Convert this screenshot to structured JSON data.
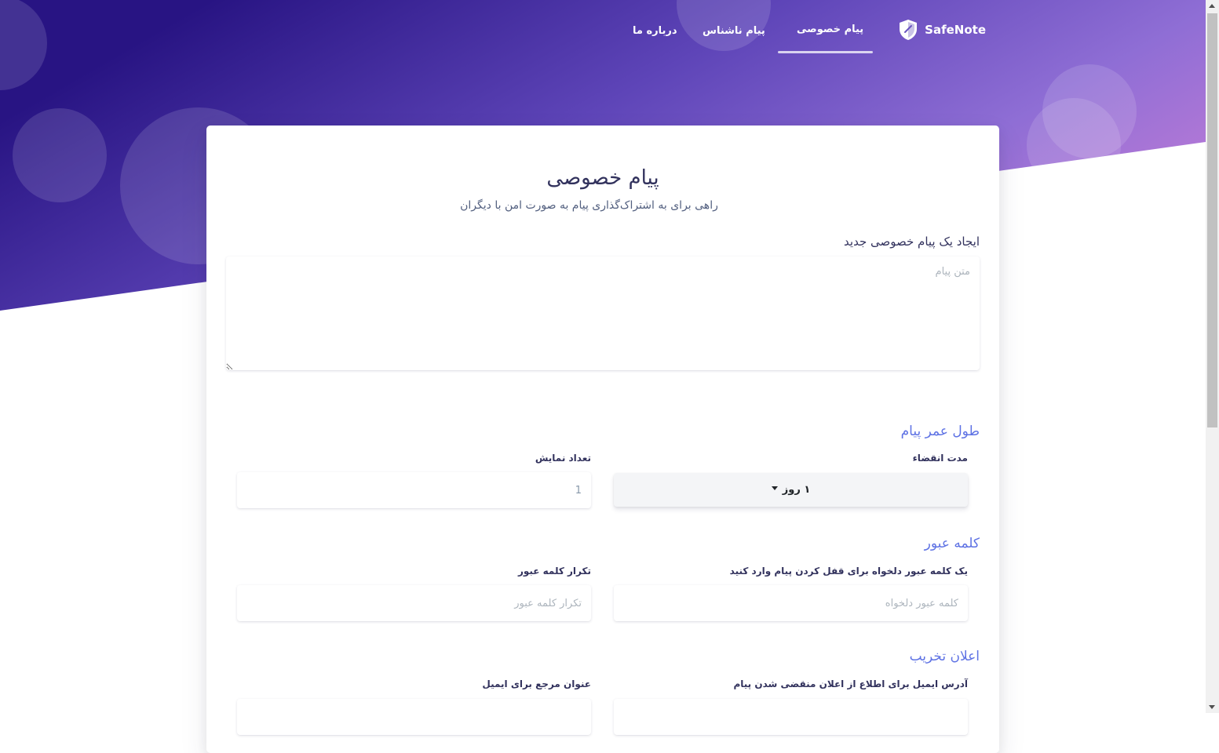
{
  "nav": {
    "brand": "SafeNote",
    "links": [
      {
        "label": "پیام خصوصی",
        "active": true
      },
      {
        "label": "پیام ناشناس",
        "active": false
      },
      {
        "label": "درباره ما",
        "active": false
      }
    ]
  },
  "card": {
    "title": "پیام خصوصی",
    "subtitle": "راهی برای به اشتراک‌گذاری پیام به صورت امن با دیگران",
    "create_label": "ایجاد یک پیام خصوصی جدید",
    "message_placeholder": "متن پیام"
  },
  "lifetime": {
    "title": "طول عمر پیام",
    "expiry_label": "مدت انقضاء",
    "expiry_value": "۱ روز",
    "views_label": "تعداد نمایش",
    "views_value": "1"
  },
  "password": {
    "title": "کلمه عبور",
    "password_label": "یک کلمه عبور دلخواه برای قفل کردن پیام وارد کنید",
    "password_placeholder": "کلمه عبور دلخواه",
    "repeat_label": "تکرار کلمه عبور",
    "repeat_placeholder": "تکرار کلمه عبور"
  },
  "notify": {
    "title": "اعلان تخریب",
    "email_label": "آدرس ایمیل برای اطلاع از اعلان منقضی شدن پیام",
    "reference_label": "عنوان مرجع برای ایمیل"
  },
  "colors": {
    "accent": "#5e72e4",
    "hero_start": "#281483",
    "hero_end": "#d782d9"
  }
}
